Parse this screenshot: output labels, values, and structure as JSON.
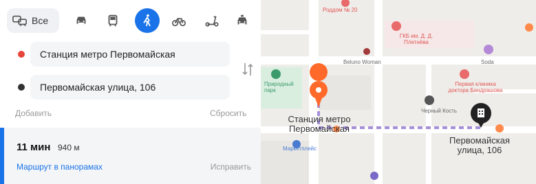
{
  "route_panel": {
    "transport_modes": [
      {
        "name": "all",
        "label": "Все"
      },
      {
        "name": "car"
      },
      {
        "name": "transit"
      },
      {
        "name": "pedestrian",
        "active": true
      },
      {
        "name": "bicycle"
      },
      {
        "name": "scooter"
      },
      {
        "name": "taxi"
      }
    ],
    "from": {
      "value": "Станция метро Первомайская",
      "dot_color": "#e8443a"
    },
    "to": {
      "value": "Первомайская улица, 106",
      "dot_color": "#333333"
    },
    "add_label": "Добавить",
    "reset_label": "Сбросить",
    "result": {
      "time": "11 мин",
      "distance": "940 м",
      "panorama_link": "Маршрут в панорамах",
      "fix_label": "Исправить"
    }
  },
  "map": {
    "start_label": "Станция метро Первомайская",
    "end_label": "Первомайская улица, 106",
    "pois": [
      {
        "label": "Роддом № 20",
        "color": "#e05555"
      },
      {
        "label": "ГКБ им. Д. Д. Плетнёва",
        "color": "#e05555"
      },
      {
        "label": "Beluno Woman",
        "color": "#666"
      },
      {
        "label": "Soda",
        "color": "#666"
      },
      {
        "label": "Черный Кость",
        "color": "#666"
      },
      {
        "label": "Первая клиника доктора Бандрашова",
        "color": "#e05555"
      },
      {
        "label": "Природный парк",
        "color": "#3a9a6a"
      },
      {
        "label": "Маркетплейс",
        "color": "#4a7bd0"
      }
    ],
    "accent_color": "#ff6a2b",
    "route_color": "#a58fd8"
  }
}
